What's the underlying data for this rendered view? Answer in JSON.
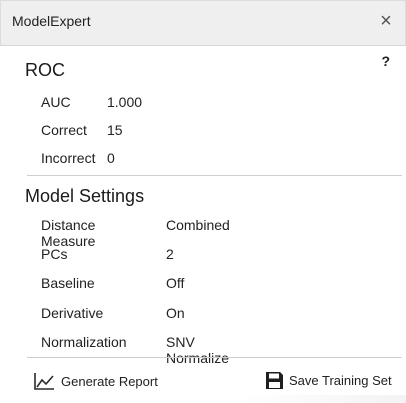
{
  "window": {
    "title": "ModelExpert",
    "close_glyph": "×"
  },
  "roc": {
    "heading": "ROC",
    "help_glyph": "?",
    "rows": [
      {
        "label": "AUC",
        "value": "1.000"
      },
      {
        "label": "Correct",
        "value": "15"
      },
      {
        "label": "Incorrect",
        "value": "0"
      }
    ]
  },
  "model_settings": {
    "heading": "Model Settings",
    "rows": [
      {
        "label": "Distance Measure",
        "value": "Combined"
      },
      {
        "label": "PCs",
        "value": "2"
      },
      {
        "label": "Baseline",
        "value": "Off"
      },
      {
        "label": "Derivative",
        "value": "On"
      },
      {
        "label": "Normalization",
        "value": "SNV Normalize"
      }
    ]
  },
  "footer": {
    "generate_report": {
      "label": "Generate Report",
      "icon": "line-chart-icon"
    },
    "save_training_set": {
      "label": "Save Training Set",
      "icon": "floppy-disk-icon"
    }
  },
  "colors": {
    "titlebar": "#efefef",
    "divider": "#cfcfcf",
    "text": "#222222"
  }
}
